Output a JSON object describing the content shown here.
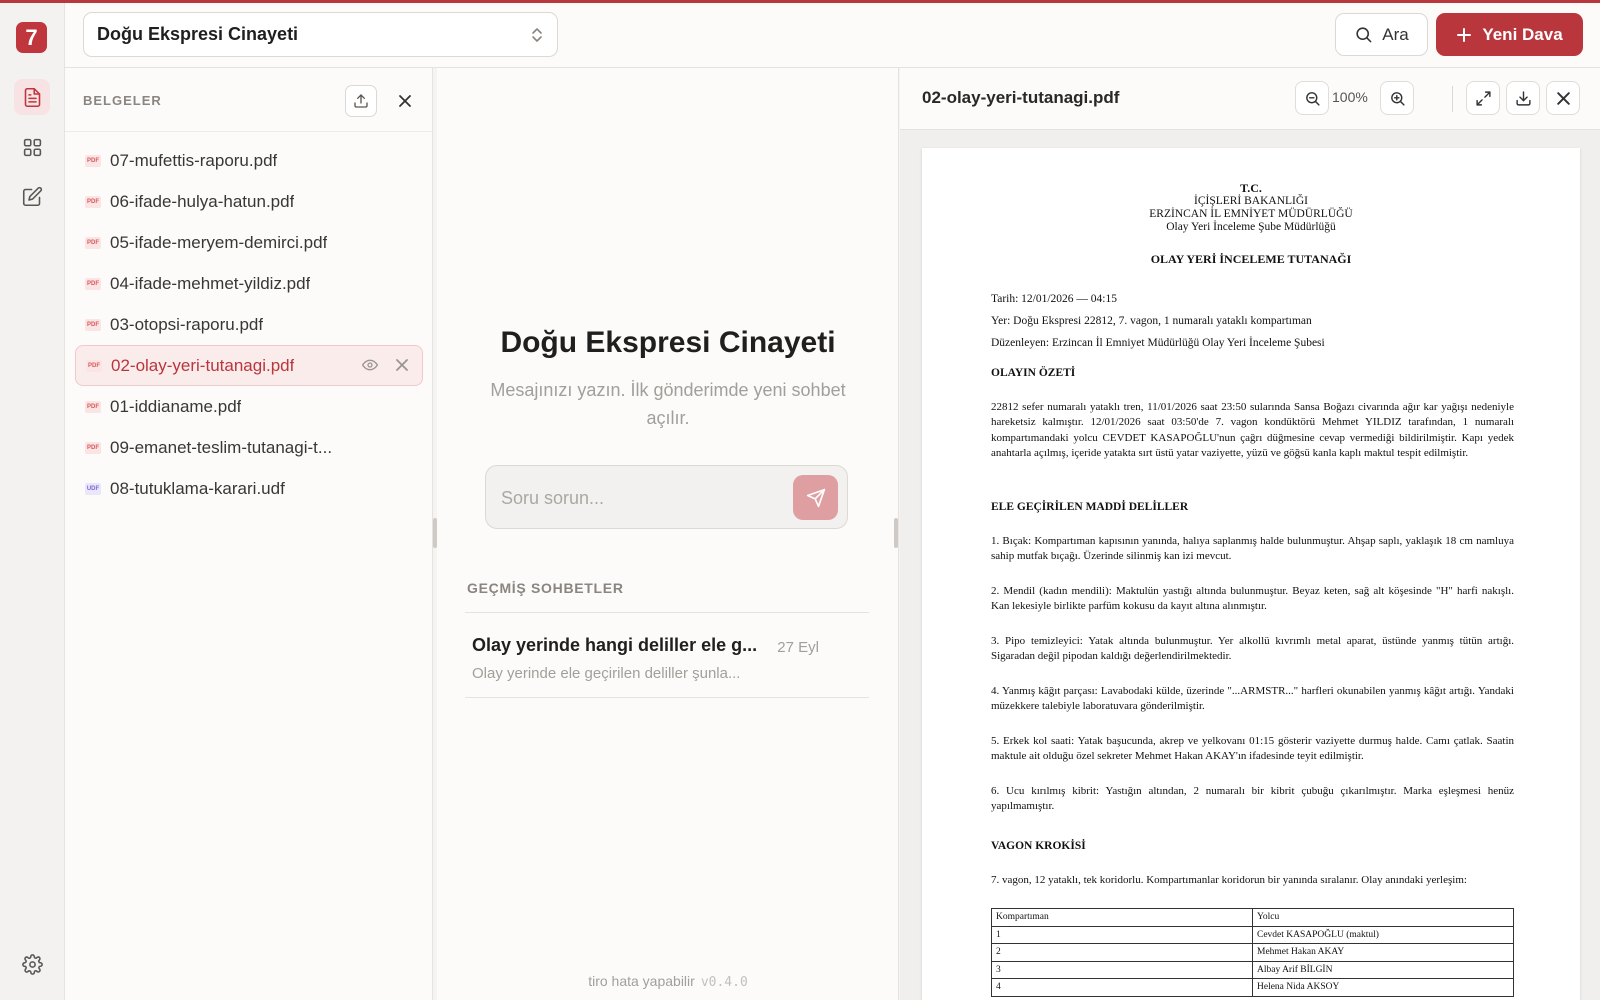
{
  "app": {
    "logo_text": "7"
  },
  "topbar": {
    "case_name": "Doğu Ekspresi Cinayeti",
    "search_label": "Ara",
    "new_case_label": "Yeni Dava"
  },
  "rail": {
    "items": [
      "documents-icon",
      "grid-icon",
      "edit-icon"
    ],
    "settings": "gear-icon"
  },
  "documents": {
    "title": "BELGELER",
    "files": [
      {
        "name": "07-mufettis-raporu.pdf",
        "type": "PDF"
      },
      {
        "name": "06-ifade-hulya-hatun.pdf",
        "type": "PDF"
      },
      {
        "name": "05-ifade-meryem-demirci.pdf",
        "type": "PDF"
      },
      {
        "name": "04-ifade-mehmet-yildiz.pdf",
        "type": "PDF"
      },
      {
        "name": "03-otopsi-raporu.pdf",
        "type": "PDF"
      },
      {
        "name": "02-olay-yeri-tutanagi.pdf",
        "type": "PDF",
        "selected": true
      },
      {
        "name": "01-iddianame.pdf",
        "type": "PDF"
      },
      {
        "name": "09-emanet-teslim-tutanagi-t...",
        "type": "PDF"
      },
      {
        "name": "08-tutuklama-karari.udf",
        "type": "UDF"
      }
    ]
  },
  "chat": {
    "title": "Doğu Ekspresi Cinayeti",
    "subtitle": "Mesajınızı yazın. İlk gönderimde yeni sohbet açılır.",
    "input_placeholder": "Soru sorun...",
    "history_title": "GEÇMİŞ SOHBETLER",
    "history": [
      {
        "question": "Olay yerinde hangi deliller ele g...",
        "date": "27 Eyl",
        "preview": "Olay yerinde ele geçirilen deliller şunla..."
      }
    ],
    "footer": "tiro hata yapabilir",
    "version": "v0.4.0"
  },
  "viewer": {
    "file_name": "02-olay-yeri-tutanagi.pdf",
    "zoom": "100%",
    "document": {
      "header_lines": [
        "T.C.",
        "İÇİŞLERİ BAKANLIĞI",
        "ERZİNCAN İL EMNİYET MÜDÜRLÜĞÜ",
        "Olay Yeri İnceleme Şube Müdürlüğü"
      ],
      "title": "OLAY YERİ İNCELEME TUTANAĞI",
      "meta": [
        "Tarih: 12/01/2026 — 04:15",
        "Yer: Doğu Ekspresi 22812, 7. vagon, 1 numaralı yataklı kompartıman",
        "Düzenleyen: Erzincan İl Emniyet Müdürlüğü Olay Yeri İnceleme Şubesi"
      ],
      "section_summary": "OLAYIN ÖZETİ",
      "summary": "22812 sefer numaralı yataklı tren, 11/01/2026 saat 23:50 sularında Sansa Boğazı civarında ağır kar yağışı nedeniyle hareketsiz kalmıştır. 12/01/2026 saat 03:50'de 7. vagon kondüktörü Mehmet YILDIZ tarafından, 1 numaralı kompartımandaki yolcu CEVDET KASAPOĞLU'nun çağrı düğmesine cevap vermediği bildirilmiştir. Kapı yedek anahtarla açılmış, içeride yatakta sırt üstü yatar vaziyette, yüzü ve göğsü kanla kaplı maktul tespit edilmiştir.",
      "section_evidence": "ELE GEÇİRİLEN MADDİ DELİLLER",
      "evidence": [
        "1. Bıçak: Kompartıman kapısının yanında, halıya saplanmış halde bulunmuştur. Ahşap saplı, yaklaşık 18 cm namluya sahip mutfak bıçağı. Üzerinde silinmiş kan izi mevcut.",
        "2. Mendil (kadın mendili): Maktulün yastığı altında bulunmuştur. Beyaz keten, sağ alt köşesinde \"H\" harfi nakışlı. Kan lekesiyle birlikte parfüm kokusu da kayıt altına alınmıştır.",
        "3. Pipo temizleyici: Yatak altında bulunmuştur. Yer alkollü kıvrımlı metal aparat, üstünde yanmış tütün artığı. Sigaradan değil pipodan kaldığı değerlendirilmektedir.",
        "4. Yanmış kâğıt parçası: Lavabodaki külde, üzerinde \"...ARMSTR...\" harfleri okunabilen yanmış kâğıt artığı. Yandaki müzekkere talebiyle laboratuvara gönderilmiştir.",
        "5. Erkek kol saati: Yatak başucunda, akrep ve yelkovanı 01:15 gösterir vaziyette durmuş halde. Camı çatlak. Saatin maktule ait olduğu özel sekreter Mehmet Hakan AKAY'ın ifadesinde teyit edilmiştir.",
        "6. Ucu kırılmış kibrit: Yastığın altından, 2 numaralı bir kibrit çubuğu çıkarılmıştır. Marka eşleşmesi henüz yapılmamıştır."
      ],
      "section_sketch": "VAGON KROKİSİ",
      "sketch_intro": "7. vagon, 12 yataklı, tek koridorlu. Kompartımanlar koridorun bir yanında sıralanır. Olay anındaki yerleşim:",
      "table_headers": [
        "Kompartıman",
        "Yolcu"
      ],
      "table_rows": [
        [
          "1",
          "Cevdet KASAPOĞLU (maktul)"
        ],
        [
          "2",
          "Mehmet Hakan AKAY"
        ],
        [
          "3",
          "Albay Arif BİLGİN"
        ],
        [
          "4",
          "Helena Nida AKSOY"
        ]
      ]
    }
  },
  "colors": {
    "accent": "#b8363c",
    "accent_soft": "#fbecec",
    "muted": "#a39e99"
  }
}
